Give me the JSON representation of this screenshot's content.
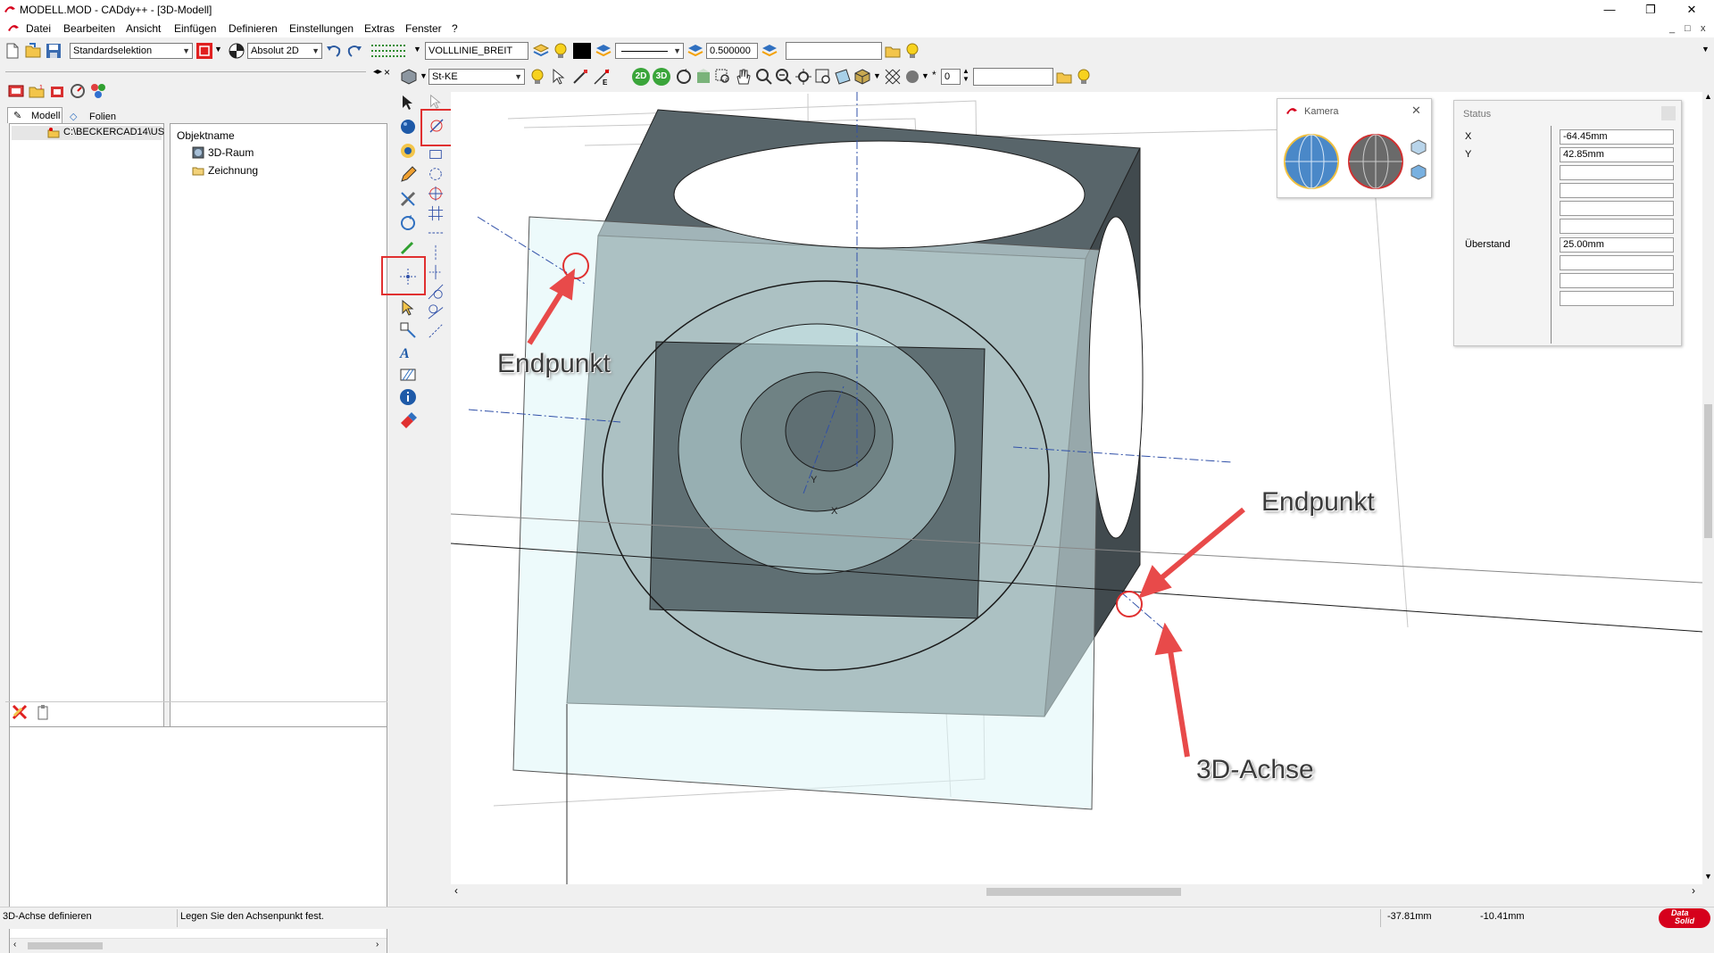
{
  "window": {
    "title": "MODELL.MOD  -  CADdy++ - [3D-Modell]",
    "minimize": "—",
    "restore": "❐",
    "close": "✕"
  },
  "menu": {
    "items": [
      "Datei",
      "Bearbeiten",
      "Ansicht",
      "Einfügen",
      "Definieren",
      "Einstellungen",
      "Extras",
      "Fenster",
      "?"
    ],
    "mdi_min": "_",
    "mdi_restore": "□",
    "mdi_close": "x"
  },
  "toolbar1": {
    "selection_mode": "Standardselektion",
    "coord_mode": "Absolut 2D",
    "linetype_name": "VOLLLINIE_BREIT",
    "line_width": "0.500000",
    "extra_input": ""
  },
  "toolbar2": {
    "layer_name": "St-KE",
    "label_2d": "2D",
    "label_3d": "3D",
    "step_value": "0",
    "extra_input": ""
  },
  "left_panel": {
    "tabs": [
      "Modell",
      "Folien"
    ],
    "path": "C:\\BECKERCAD14\\US",
    "column_header": "Objektname",
    "tree_items": [
      "3D-Raum",
      "Zeichnung"
    ]
  },
  "camera_window": {
    "title": "Kamera",
    "close": "✕"
  },
  "status_window": {
    "title": "Status",
    "rows": [
      {
        "label": "X",
        "value": "-64.45mm"
      },
      {
        "label": "Y",
        "value": "42.85mm"
      },
      {
        "label": "",
        "value": ""
      },
      {
        "label": "",
        "value": ""
      },
      {
        "label": "",
        "value": ""
      },
      {
        "label": "",
        "value": ""
      },
      {
        "label": "Überstand",
        "value": "25.00mm"
      },
      {
        "label": "",
        "value": ""
      },
      {
        "label": "",
        "value": ""
      },
      {
        "label": "",
        "value": ""
      }
    ]
  },
  "annotations": {
    "endpoint_top": "Endpunkt",
    "endpoint_right": "Endpunkt",
    "axis_label": "3D-Achse"
  },
  "axis_letters": {
    "x": "X",
    "y": "Y"
  },
  "statusbar": {
    "command": "3D-Achse definieren",
    "prompt": "Legen Sie den Achsenpunkt fest.",
    "coord_x": "-37.81mm",
    "coord_y": "-10.41mm",
    "logo_top": "Data",
    "logo_bottom": "Solid"
  },
  "colors": {
    "highlight_box": "#e03030",
    "arrow": "#e84a4a",
    "solid_face": "#6f8284",
    "plane_fill": "#dff5f7",
    "accent_red": "#d6001c",
    "axis_line": "#3050a8"
  }
}
